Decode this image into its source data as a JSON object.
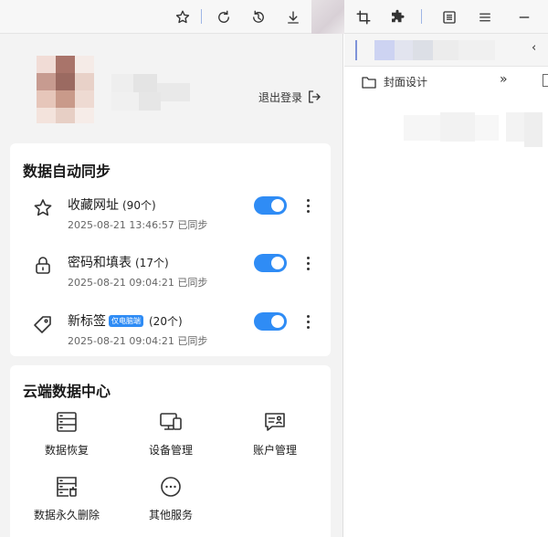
{
  "toolbar": {
    "icons": [
      "star-icon",
      "refresh-icon",
      "history-icon",
      "download-icon",
      "crop-icon",
      "puzzle-icon",
      "reading-list-icon",
      "menu-icon",
      "minimize-icon"
    ]
  },
  "account": {
    "logout_label": "退出登录"
  },
  "sync": {
    "title": "数据自动同步",
    "items": [
      {
        "name": "收藏网址",
        "count": "(90个)",
        "time": "2025-08-21 13:46:57 已同步",
        "badge": "",
        "icon": "star-icon",
        "enabled": true
      },
      {
        "name": "密码和填表",
        "count": "(17个)",
        "time": "2025-08-21 09:04:21 已同步",
        "badge": "",
        "icon": "lock-icon",
        "enabled": true
      },
      {
        "name": "新标签",
        "count": "(20个)",
        "time": "2025-08-21 09:04:21 已同步",
        "badge": "仅电脑端",
        "icon": "tag-icon",
        "enabled": true
      }
    ]
  },
  "cloud": {
    "title": "云端数据中心",
    "tiles": [
      {
        "label": "数据恢复",
        "icon": "data-restore-icon"
      },
      {
        "label": "设备管理",
        "icon": "devices-icon"
      },
      {
        "label": "账户管理",
        "icon": "account-icon"
      },
      {
        "label": "数据永久删除",
        "icon": "data-delete-icon"
      },
      {
        "label": "其他服务",
        "icon": "more-services-icon"
      }
    ]
  },
  "bookmarks_bar": {
    "folder_label": "封面设计",
    "overflow_label": "»"
  },
  "colors": {
    "accent": "#2f8cf5",
    "panel_bg": "#f3f3f3",
    "card_bg": "#ffffff"
  }
}
